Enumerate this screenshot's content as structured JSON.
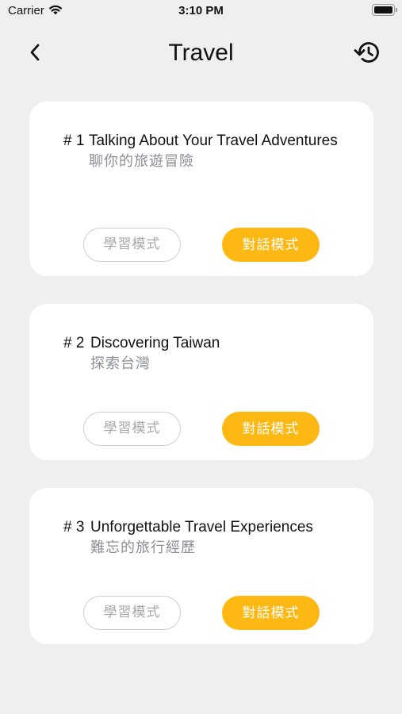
{
  "status_bar": {
    "carrier": "Carrier",
    "time": "3:10 PM"
  },
  "nav": {
    "title": "Travel",
    "back_icon": "chevron-left-icon",
    "history_icon": "history-icon"
  },
  "lessons": [
    {
      "number": "# 1",
      "title_en": "Talking About Your Travel Adventures",
      "title_zh": "聊你的旅遊冒險",
      "study_label": "學習模式",
      "chat_label": "對話模式"
    },
    {
      "number": "# 2",
      "title_en": "Discovering Taiwan",
      "title_zh": "探索台灣",
      "study_label": "學習模式",
      "chat_label": "對話模式"
    },
    {
      "number": "# 3",
      "title_en": "Unforgettable Travel Experiences",
      "title_zh": "難忘的旅行經歷",
      "study_label": "學習模式",
      "chat_label": "對話模式"
    }
  ],
  "colors": {
    "accent": "#fdb813",
    "background": "#efefef",
    "card": "#ffffff",
    "subtitle": "#8a8f96"
  }
}
